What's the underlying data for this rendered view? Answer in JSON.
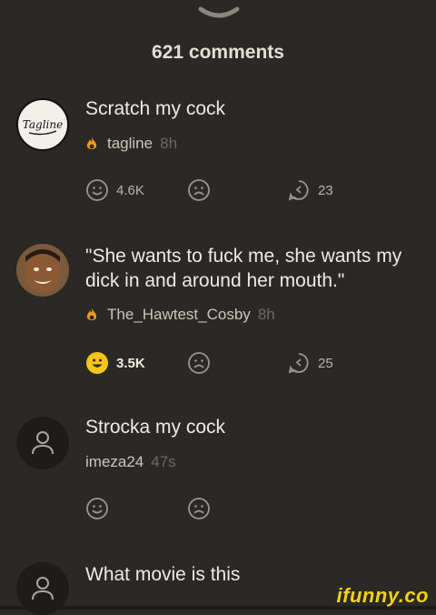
{
  "header": {
    "count_label": "621 comments"
  },
  "colors": {
    "background": "#2b2925",
    "accent_fire": "#f29a1d",
    "smile_active": "#f5c518",
    "watermark": "#f3d20e"
  },
  "comments": [
    {
      "text": "Scratch my cock",
      "author": "tagline",
      "time": "8h",
      "avatar": "tagline-logo",
      "avatar_text": "Tagline",
      "fire": true,
      "smiles": "4.6K",
      "smile_active": false,
      "replies": "23"
    },
    {
      "text": "\"She wants to fuck me, she wants my dick in and around her mouth.\"",
      "author": "The_Hawtest_Cosby",
      "time": "8h",
      "avatar": "person-photo",
      "fire": true,
      "smiles": "3.5K",
      "smile_active": true,
      "replies": "25"
    },
    {
      "text": "Strocka my cock",
      "author": "imeza24",
      "time": "47s",
      "avatar": "user-placeholder-icon",
      "fire": false
    },
    {
      "text": "What movie is this",
      "avatar": "user-placeholder-icon"
    }
  ],
  "watermark": "ifunny.co"
}
